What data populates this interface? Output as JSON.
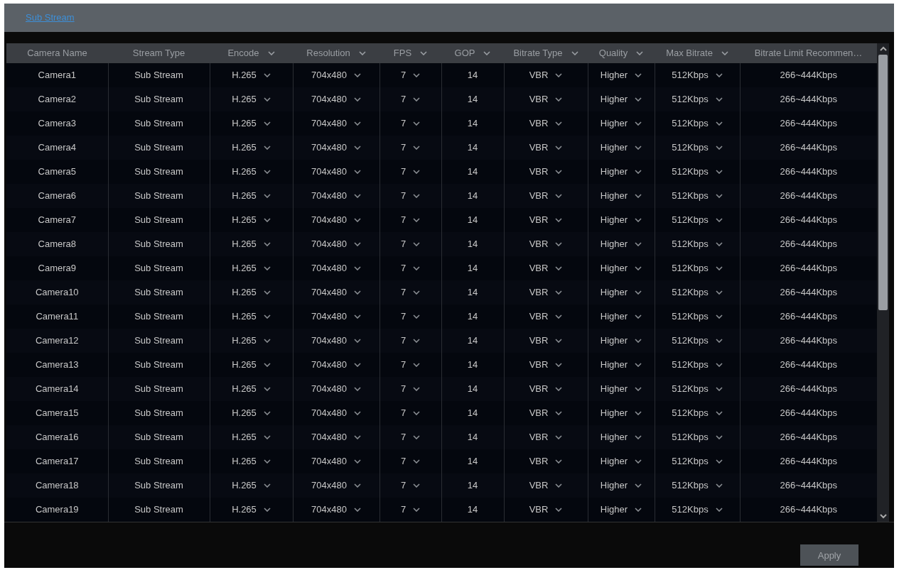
{
  "tabs": [
    {
      "label": "Sub Stream",
      "selected": true
    }
  ],
  "table": {
    "columns": [
      {
        "label": "Camera Name",
        "dropdown": false,
        "kind": "text"
      },
      {
        "label": "Stream Type",
        "dropdown": false,
        "kind": "text"
      },
      {
        "label": "Encode",
        "dropdown": true,
        "kind": "select"
      },
      {
        "label": "Resolution",
        "dropdown": true,
        "kind": "select"
      },
      {
        "label": "FPS",
        "dropdown": true,
        "kind": "select"
      },
      {
        "label": "GOP",
        "dropdown": true,
        "kind": "text"
      },
      {
        "label": "Bitrate Type",
        "dropdown": true,
        "kind": "select"
      },
      {
        "label": "Quality",
        "dropdown": true,
        "kind": "select"
      },
      {
        "label": "Max Bitrate",
        "dropdown": true,
        "kind": "select"
      },
      {
        "label": "Bitrate Limit Recommen…",
        "dropdown": false,
        "kind": "text"
      }
    ],
    "rows": [
      [
        "Camera1",
        "Sub Stream",
        "H.265",
        "704x480",
        "7",
        "14",
        "VBR",
        "Higher",
        "512Kbps",
        "266~444Kbps"
      ],
      [
        "Camera2",
        "Sub Stream",
        "H.265",
        "704x480",
        "7",
        "14",
        "VBR",
        "Higher",
        "512Kbps",
        "266~444Kbps"
      ],
      [
        "Camera3",
        "Sub Stream",
        "H.265",
        "704x480",
        "7",
        "14",
        "VBR",
        "Higher",
        "512Kbps",
        "266~444Kbps"
      ],
      [
        "Camera4",
        "Sub Stream",
        "H.265",
        "704x480",
        "7",
        "14",
        "VBR",
        "Higher",
        "512Kbps",
        "266~444Kbps"
      ],
      [
        "Camera5",
        "Sub Stream",
        "H.265",
        "704x480",
        "7",
        "14",
        "VBR",
        "Higher",
        "512Kbps",
        "266~444Kbps"
      ],
      [
        "Camera6",
        "Sub Stream",
        "H.265",
        "704x480",
        "7",
        "14",
        "VBR",
        "Higher",
        "512Kbps",
        "266~444Kbps"
      ],
      [
        "Camera7",
        "Sub Stream",
        "H.265",
        "704x480",
        "7",
        "14",
        "VBR",
        "Higher",
        "512Kbps",
        "266~444Kbps"
      ],
      [
        "Camera8",
        "Sub Stream",
        "H.265",
        "704x480",
        "7",
        "14",
        "VBR",
        "Higher",
        "512Kbps",
        "266~444Kbps"
      ],
      [
        "Camera9",
        "Sub Stream",
        "H.265",
        "704x480",
        "7",
        "14",
        "VBR",
        "Higher",
        "512Kbps",
        "266~444Kbps"
      ],
      [
        "Camera10",
        "Sub Stream",
        "H.265",
        "704x480",
        "7",
        "14",
        "VBR",
        "Higher",
        "512Kbps",
        "266~444Kbps"
      ],
      [
        "Camera11",
        "Sub Stream",
        "H.265",
        "704x480",
        "7",
        "14",
        "VBR",
        "Higher",
        "512Kbps",
        "266~444Kbps"
      ],
      [
        "Camera12",
        "Sub Stream",
        "H.265",
        "704x480",
        "7",
        "14",
        "VBR",
        "Higher",
        "512Kbps",
        "266~444Kbps"
      ],
      [
        "Camera13",
        "Sub Stream",
        "H.265",
        "704x480",
        "7",
        "14",
        "VBR",
        "Higher",
        "512Kbps",
        "266~444Kbps"
      ],
      [
        "Camera14",
        "Sub Stream",
        "H.265",
        "704x480",
        "7",
        "14",
        "VBR",
        "Higher",
        "512Kbps",
        "266~444Kbps"
      ],
      [
        "Camera15",
        "Sub Stream",
        "H.265",
        "704x480",
        "7",
        "14",
        "VBR",
        "Higher",
        "512Kbps",
        "266~444Kbps"
      ],
      [
        "Camera16",
        "Sub Stream",
        "H.265",
        "704x480",
        "7",
        "14",
        "VBR",
        "Higher",
        "512Kbps",
        "266~444Kbps"
      ],
      [
        "Camera17",
        "Sub Stream",
        "H.265",
        "704x480",
        "7",
        "14",
        "VBR",
        "Higher",
        "512Kbps",
        "266~444Kbps"
      ],
      [
        "Camera18",
        "Sub Stream",
        "H.265",
        "704x480",
        "7",
        "14",
        "VBR",
        "Higher",
        "512Kbps",
        "266~444Kbps"
      ],
      [
        "Camera19",
        "Sub Stream",
        "H.265",
        "704x480",
        "7",
        "14",
        "VBR",
        "Higher",
        "512Kbps",
        "266~444Kbps"
      ]
    ]
  },
  "buttons": [
    {
      "label": "Apply"
    }
  ]
}
